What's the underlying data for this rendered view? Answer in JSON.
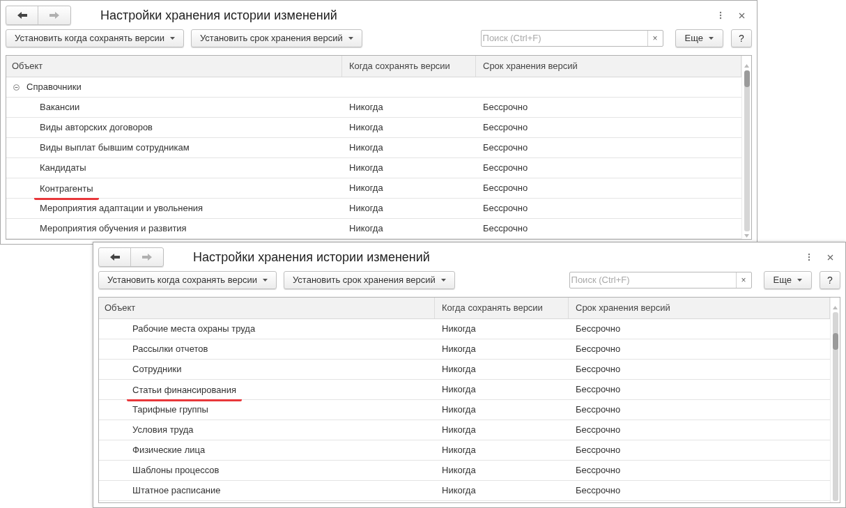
{
  "windows": [
    {
      "title": "Настройки хранения истории изменений",
      "back_disabled": false,
      "forward_disabled": true,
      "toolbar": [
        "Установить когда сохранять версии",
        "Установить срок хранения версий"
      ],
      "search": {
        "placeholder": "Поиск (Ctrl+F)",
        "clear": "×"
      },
      "more": "Еще",
      "help": "?",
      "columns": [
        "Объект",
        "Когда сохранять версии",
        "Срок хранения версий"
      ],
      "rows": [
        {
          "kind": "group",
          "label": "Справочники",
          "expanded": true,
          "marked": false,
          "children": [
            {
              "kind": "item",
              "label": "Вакансии",
              "when": "Никогда",
              "term": "Бессрочно",
              "marked": false
            },
            {
              "kind": "item",
              "label": "Виды авторских договоров",
              "when": "Никогда",
              "term": "Бессрочно",
              "marked": false
            },
            {
              "kind": "item",
              "label": "Виды выплат бывшим сотрудникам",
              "when": "Никогда",
              "term": "Бессрочно",
              "marked": false
            },
            {
              "kind": "item",
              "label": "Кандидаты",
              "when": "Никогда",
              "term": "Бессрочно",
              "marked": false
            },
            {
              "kind": "item",
              "label": "Контрагенты",
              "when": "Никогда",
              "term": "Бессрочно",
              "marked": true
            },
            {
              "kind": "item",
              "label": "Мероприятия адаптации и увольнения",
              "when": "Никогда",
              "term": "Бессрочно",
              "marked": false
            },
            {
              "kind": "item",
              "label": "Мероприятия обучения и развития",
              "when": "Никогда",
              "term": "Бессрочно",
              "marked": false
            }
          ]
        }
      ]
    },
    {
      "title": "Настройки хранения истории изменений",
      "back_disabled": false,
      "forward_disabled": true,
      "toolbar": [
        "Установить когда сохранять версии",
        "Установить срок хранения версий"
      ],
      "search": {
        "placeholder": "Поиск (Ctrl+F)",
        "clear": "×"
      },
      "more": "Еще",
      "help": "?",
      "columns": [
        "Объект",
        "Когда сохранять версии",
        "Срок хранения версий"
      ],
      "rows": [
        {
          "kind": "item",
          "label": "Рабочие места охраны труда",
          "when": "Никогда",
          "term": "Бессрочно",
          "marked": false
        },
        {
          "kind": "item",
          "label": "Рассылки отчетов",
          "when": "Никогда",
          "term": "Бессрочно",
          "marked": false
        },
        {
          "kind": "item",
          "label": "Сотрудники",
          "when": "Никогда",
          "term": "Бессрочно",
          "marked": false
        },
        {
          "kind": "item",
          "label": "Статьи финансирования",
          "when": "Никогда",
          "term": "Бессрочно",
          "marked": true
        },
        {
          "kind": "item",
          "label": "Тарифные группы",
          "when": "Никогда",
          "term": "Бессрочно",
          "marked": false
        },
        {
          "kind": "item",
          "label": "Условия труда",
          "when": "Никогда",
          "term": "Бессрочно",
          "marked": false
        },
        {
          "kind": "item",
          "label": "Физические лица",
          "when": "Никогда",
          "term": "Бессрочно",
          "marked": false
        },
        {
          "kind": "item",
          "label": "Шаблоны процессов",
          "when": "Никогда",
          "term": "Бессрочно",
          "marked": false
        },
        {
          "kind": "item",
          "label": "Штатное расписание",
          "when": "Никогда",
          "term": "Бессрочно",
          "marked": false
        }
      ]
    }
  ]
}
